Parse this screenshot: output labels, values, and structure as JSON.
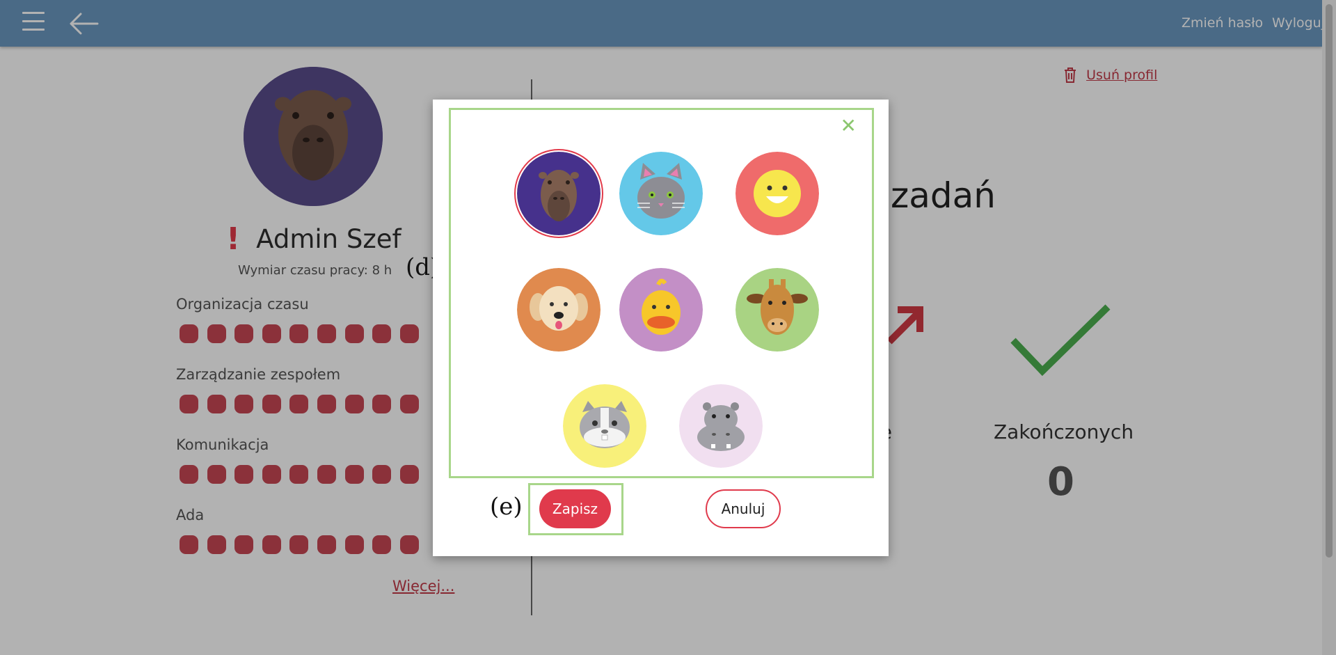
{
  "topbar": {
    "change_password": "Zmień hasło",
    "logout": "Wyloguj"
  },
  "profile": {
    "name": "Admin Szef",
    "alert_mark": "!",
    "work_time": "Wymiar czasu pracy: 8 h",
    "skills": [
      {
        "label": "Organizacja czasu"
      },
      {
        "label": "Zarządzanie zespołem"
      },
      {
        "label": "Komunikacja"
      },
      {
        "label": "Ada"
      }
    ],
    "more_link": "Więcej...",
    "delete_profile": "Usuń profil"
  },
  "stats": {
    "title_fragment": "zadań",
    "partial_label": "ie",
    "done_label": "Zakończonych",
    "done_value": "0"
  },
  "modal": {
    "close_symbol": "✕",
    "avatars": [
      {
        "icon": "capybara-icon",
        "bg": "#46318c",
        "selected": true
      },
      {
        "icon": "cat-icon",
        "bg": "#64c8e8",
        "selected": false
      },
      {
        "icon": "smiley-icon",
        "bg": "#ef6b6b",
        "selected": false
      },
      {
        "icon": "dog-icon",
        "bg": "#e08a4e",
        "selected": false
      },
      {
        "icon": "duck-icon",
        "bg": "#c38fc6",
        "selected": false
      },
      {
        "icon": "giraffe-icon",
        "bg": "#a9d383",
        "selected": false
      },
      {
        "icon": "hamster-icon",
        "bg": "#f8f07a",
        "selected": false
      },
      {
        "icon": "hippo-icon",
        "bg": "#f1dff0",
        "selected": false
      }
    ],
    "save_label": "Zapisz",
    "cancel_label": "Anuluj"
  },
  "annotations": {
    "d": "(d)",
    "e": "(e)"
  },
  "colors": {
    "topbar": "#6b98c0",
    "accent_red": "#e03a4c",
    "highlight_green": "#a8d68a",
    "selected_avatar_bg": "#46318c"
  }
}
